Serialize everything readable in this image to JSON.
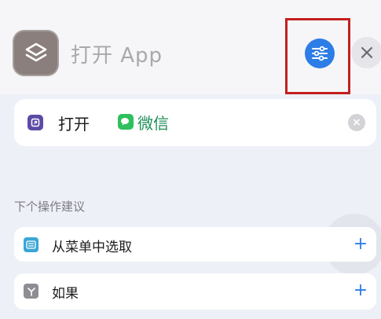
{
  "header": {
    "title": "打开 App",
    "app_icon": "shortcuts-layers-icon",
    "settings_icon": "sliders-icon",
    "close_label": "×"
  },
  "action": {
    "verb": "打开",
    "app_name": "微信",
    "verb_icon": "open-app-icon",
    "app_icon": "wechat-icon"
  },
  "suggestions": {
    "section_label": "下个操作建议",
    "items": [
      {
        "label": "从菜单中选取",
        "icon": "menu-icon",
        "add_label": "+"
      },
      {
        "label": "如果",
        "icon": "if-branch-icon",
        "add_label": "+"
      }
    ]
  },
  "colors": {
    "accent": "#2d7de6",
    "highlight": "#c4201f",
    "app_tint": "#1f8f59"
  }
}
